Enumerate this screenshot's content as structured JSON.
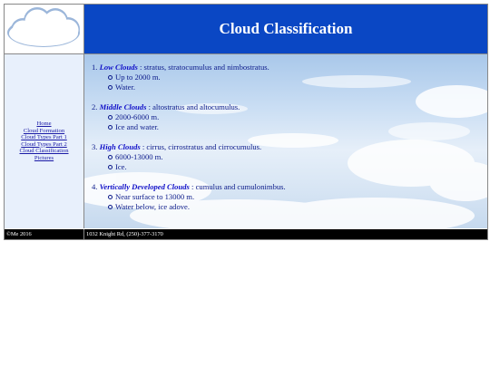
{
  "header": {
    "title": "Cloud Classification"
  },
  "logo": {
    "icon": "cloud-logo-icon"
  },
  "nav": {
    "items": [
      "Home",
      "Cloud Formation",
      "Cloud Types Part 1",
      "Cloud Types Part 2",
      "Cloud Classification",
      "Pictures"
    ]
  },
  "content": {
    "items": [
      {
        "num": "1.",
        "title": "Low Clouds",
        "rest": " : stratus, stratocumulus and nimbostratus.",
        "details": [
          "Up to 2000 m.",
          "Water."
        ]
      },
      {
        "num": "2.",
        "title": "Middle Clouds",
        "rest": " : altostratus and altocumulus.",
        "details": [
          "2000-6000 m.",
          "Ice and water."
        ]
      },
      {
        "num": "3.",
        "title": "High Clouds",
        "rest": " : cirrus, cirrostratus and cirrocumulus.",
        "details": [
          "6000-13000 m.",
          "Ice."
        ]
      },
      {
        "num": "4.",
        "title": "Vertically Developed Clouds",
        "rest": " : cumulus and cumulonimbus.",
        "details": [
          "Near surface to 13000 m.",
          "Water below, ice adove."
        ]
      }
    ]
  },
  "footer": {
    "left": "©Me 2016",
    "right": "1032 Knight Rd, (250)-377-3170"
  },
  "colors": {
    "header_bg": "#0a47c4",
    "sidebar_bg": "#e8f0fc",
    "footer_bg": "#000000"
  }
}
